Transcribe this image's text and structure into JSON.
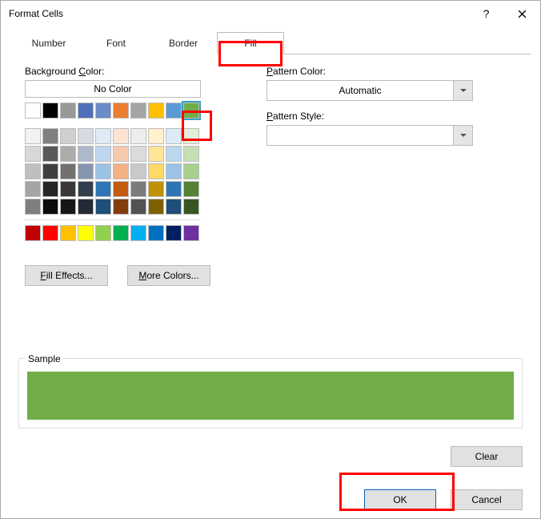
{
  "window": {
    "title": "Format Cells"
  },
  "tabs": {
    "number": "Number",
    "font": "Font",
    "border": "Border",
    "fill": "Fill"
  },
  "left": {
    "bgcolor_label_pre": "Background ",
    "bgcolor_label_u": "C",
    "bgcolor_label_post": "olor:",
    "no_color": "No Color",
    "fill_effects_u": "F",
    "fill_effects_rest": "ill Effects...",
    "more_colors_u": "M",
    "more_colors_rest": "ore Colors..."
  },
  "right": {
    "pattern_color_u": "P",
    "pattern_color_rest": "attern Color:",
    "automatic": "Automatic",
    "pattern_style_u": "P",
    "pattern_style_rest": "attern Style:"
  },
  "sample": {
    "label": "Sample",
    "color": "#70AD47"
  },
  "buttons": {
    "clear": "Clear",
    "ok": "OK",
    "cancel": "Cancel"
  },
  "swatches": {
    "theme_row": [
      "#FFFFFF",
      "#000000",
      "#999999",
      "#4F6FB8",
      "#6B8BC9",
      "#ED7D31",
      "#A5A5A5",
      "#FFC000",
      "#5B9BD5",
      "#70AD47"
    ],
    "shades": [
      [
        "#F2F2F2",
        "#7F7F7F",
        "#D0CECE",
        "#D6DCE4",
        "#DEEBF6",
        "#FCE4D5",
        "#EDEDED",
        "#FFF2CC",
        "#DDEBF6",
        "#E2EFD9"
      ],
      [
        "#D8D8D8",
        "#595959",
        "#AEABAB",
        "#ADB9CA",
        "#BDD7EE",
        "#F7CAAC",
        "#DBDBDB",
        "#FEE599",
        "#BDD7EE",
        "#C5E0B3"
      ],
      [
        "#BFBFBF",
        "#3F3F3F",
        "#757070",
        "#8496B0",
        "#9CC3E5",
        "#F4B183",
        "#C9C9C9",
        "#FFD965",
        "#9CC3E5",
        "#A8D08D"
      ],
      [
        "#A5A5A5",
        "#262626",
        "#3A3838",
        "#323F4F",
        "#2E75B5",
        "#C55A11",
        "#7B7B7B",
        "#BF9000",
        "#2E75B5",
        "#538135"
      ],
      [
        "#7F7F7F",
        "#0C0C0C",
        "#171616",
        "#222A35",
        "#1E4E79",
        "#833C0B",
        "#525252",
        "#7F6000",
        "#1E4E79",
        "#375623"
      ]
    ],
    "standard": [
      "#C00000",
      "#FF0000",
      "#FFC000",
      "#FFFF00",
      "#92D050",
      "#00B050",
      "#00B0F0",
      "#0070C0",
      "#002060",
      "#7030A0"
    ],
    "selected_color": "#70AD47"
  }
}
